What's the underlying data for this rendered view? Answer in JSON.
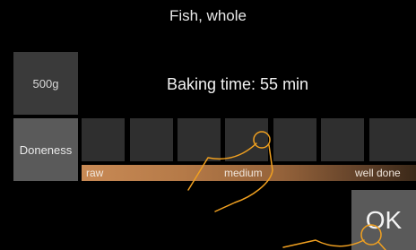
{
  "header": {
    "title": "Fish, whole"
  },
  "weight": {
    "label": "500g"
  },
  "baking": {
    "text": "Baking time: 55 min"
  },
  "doneness": {
    "label": "Doneness",
    "levels_count": 7,
    "selected_index": 3,
    "scale": {
      "min_label": "raw",
      "mid_label": "medium",
      "max_label": "well done"
    }
  },
  "actions": {
    "ok_label": "OK"
  },
  "colors": {
    "background": "#000000",
    "accent": "#f0a020",
    "scale_start": "#c98a55",
    "scale_end": "#3a2818"
  },
  "icons": {
    "gesture": "finger-tap-icon"
  }
}
